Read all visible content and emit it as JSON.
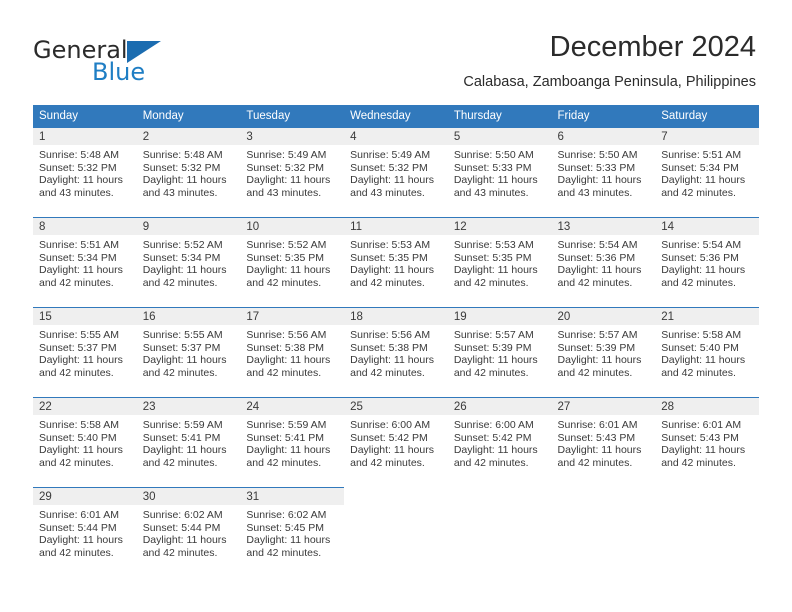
{
  "brand": {
    "name_part1": "General",
    "name_part2": "Blue",
    "triangle_icon": "blue-triangle-logo-mark",
    "accent_color": "#1b6cb0"
  },
  "header": {
    "title": "December 2024",
    "subtitle": "Calabasa, Zamboanga Peninsula, Philippines"
  },
  "calendar": {
    "header_bg": "#3179bc",
    "daynum_bg": "#efefef",
    "weekdays": [
      "Sunday",
      "Monday",
      "Tuesday",
      "Wednesday",
      "Thursday",
      "Friday",
      "Saturday"
    ],
    "weeks": [
      [
        {
          "day": "1",
          "sunrise": "Sunrise: 5:48 AM",
          "sunset": "Sunset: 5:32 PM",
          "daylight1": "Daylight: 11 hours",
          "daylight2": "and 43 minutes."
        },
        {
          "day": "2",
          "sunrise": "Sunrise: 5:48 AM",
          "sunset": "Sunset: 5:32 PM",
          "daylight1": "Daylight: 11 hours",
          "daylight2": "and 43 minutes."
        },
        {
          "day": "3",
          "sunrise": "Sunrise: 5:49 AM",
          "sunset": "Sunset: 5:32 PM",
          "daylight1": "Daylight: 11 hours",
          "daylight2": "and 43 minutes."
        },
        {
          "day": "4",
          "sunrise": "Sunrise: 5:49 AM",
          "sunset": "Sunset: 5:32 PM",
          "daylight1": "Daylight: 11 hours",
          "daylight2": "and 43 minutes."
        },
        {
          "day": "5",
          "sunrise": "Sunrise: 5:50 AM",
          "sunset": "Sunset: 5:33 PM",
          "daylight1": "Daylight: 11 hours",
          "daylight2": "and 43 minutes."
        },
        {
          "day": "6",
          "sunrise": "Sunrise: 5:50 AM",
          "sunset": "Sunset: 5:33 PM",
          "daylight1": "Daylight: 11 hours",
          "daylight2": "and 43 minutes."
        },
        {
          "day": "7",
          "sunrise": "Sunrise: 5:51 AM",
          "sunset": "Sunset: 5:34 PM",
          "daylight1": "Daylight: 11 hours",
          "daylight2": "and 42 minutes."
        }
      ],
      [
        {
          "day": "8",
          "sunrise": "Sunrise: 5:51 AM",
          "sunset": "Sunset: 5:34 PM",
          "daylight1": "Daylight: 11 hours",
          "daylight2": "and 42 minutes."
        },
        {
          "day": "9",
          "sunrise": "Sunrise: 5:52 AM",
          "sunset": "Sunset: 5:34 PM",
          "daylight1": "Daylight: 11 hours",
          "daylight2": "and 42 minutes."
        },
        {
          "day": "10",
          "sunrise": "Sunrise: 5:52 AM",
          "sunset": "Sunset: 5:35 PM",
          "daylight1": "Daylight: 11 hours",
          "daylight2": "and 42 minutes."
        },
        {
          "day": "11",
          "sunrise": "Sunrise: 5:53 AM",
          "sunset": "Sunset: 5:35 PM",
          "daylight1": "Daylight: 11 hours",
          "daylight2": "and 42 minutes."
        },
        {
          "day": "12",
          "sunrise": "Sunrise: 5:53 AM",
          "sunset": "Sunset: 5:35 PM",
          "daylight1": "Daylight: 11 hours",
          "daylight2": "and 42 minutes."
        },
        {
          "day": "13",
          "sunrise": "Sunrise: 5:54 AM",
          "sunset": "Sunset: 5:36 PM",
          "daylight1": "Daylight: 11 hours",
          "daylight2": "and 42 minutes."
        },
        {
          "day": "14",
          "sunrise": "Sunrise: 5:54 AM",
          "sunset": "Sunset: 5:36 PM",
          "daylight1": "Daylight: 11 hours",
          "daylight2": "and 42 minutes."
        }
      ],
      [
        {
          "day": "15",
          "sunrise": "Sunrise: 5:55 AM",
          "sunset": "Sunset: 5:37 PM",
          "daylight1": "Daylight: 11 hours",
          "daylight2": "and 42 minutes."
        },
        {
          "day": "16",
          "sunrise": "Sunrise: 5:55 AM",
          "sunset": "Sunset: 5:37 PM",
          "daylight1": "Daylight: 11 hours",
          "daylight2": "and 42 minutes."
        },
        {
          "day": "17",
          "sunrise": "Sunrise: 5:56 AM",
          "sunset": "Sunset: 5:38 PM",
          "daylight1": "Daylight: 11 hours",
          "daylight2": "and 42 minutes."
        },
        {
          "day": "18",
          "sunrise": "Sunrise: 5:56 AM",
          "sunset": "Sunset: 5:38 PM",
          "daylight1": "Daylight: 11 hours",
          "daylight2": "and 42 minutes."
        },
        {
          "day": "19",
          "sunrise": "Sunrise: 5:57 AM",
          "sunset": "Sunset: 5:39 PM",
          "daylight1": "Daylight: 11 hours",
          "daylight2": "and 42 minutes."
        },
        {
          "day": "20",
          "sunrise": "Sunrise: 5:57 AM",
          "sunset": "Sunset: 5:39 PM",
          "daylight1": "Daylight: 11 hours",
          "daylight2": "and 42 minutes."
        },
        {
          "day": "21",
          "sunrise": "Sunrise: 5:58 AM",
          "sunset": "Sunset: 5:40 PM",
          "daylight1": "Daylight: 11 hours",
          "daylight2": "and 42 minutes."
        }
      ],
      [
        {
          "day": "22",
          "sunrise": "Sunrise: 5:58 AM",
          "sunset": "Sunset: 5:40 PM",
          "daylight1": "Daylight: 11 hours",
          "daylight2": "and 42 minutes."
        },
        {
          "day": "23",
          "sunrise": "Sunrise: 5:59 AM",
          "sunset": "Sunset: 5:41 PM",
          "daylight1": "Daylight: 11 hours",
          "daylight2": "and 42 minutes."
        },
        {
          "day": "24",
          "sunrise": "Sunrise: 5:59 AM",
          "sunset": "Sunset: 5:41 PM",
          "daylight1": "Daylight: 11 hours",
          "daylight2": "and 42 minutes."
        },
        {
          "day": "25",
          "sunrise": "Sunrise: 6:00 AM",
          "sunset": "Sunset: 5:42 PM",
          "daylight1": "Daylight: 11 hours",
          "daylight2": "and 42 minutes."
        },
        {
          "day": "26",
          "sunrise": "Sunrise: 6:00 AM",
          "sunset": "Sunset: 5:42 PM",
          "daylight1": "Daylight: 11 hours",
          "daylight2": "and 42 minutes."
        },
        {
          "day": "27",
          "sunrise": "Sunrise: 6:01 AM",
          "sunset": "Sunset: 5:43 PM",
          "daylight1": "Daylight: 11 hours",
          "daylight2": "and 42 minutes."
        },
        {
          "day": "28",
          "sunrise": "Sunrise: 6:01 AM",
          "sunset": "Sunset: 5:43 PM",
          "daylight1": "Daylight: 11 hours",
          "daylight2": "and 42 minutes."
        }
      ],
      [
        {
          "day": "29",
          "sunrise": "Sunrise: 6:01 AM",
          "sunset": "Sunset: 5:44 PM",
          "daylight1": "Daylight: 11 hours",
          "daylight2": "and 42 minutes."
        },
        {
          "day": "30",
          "sunrise": "Sunrise: 6:02 AM",
          "sunset": "Sunset: 5:44 PM",
          "daylight1": "Daylight: 11 hours",
          "daylight2": "and 42 minutes."
        },
        {
          "day": "31",
          "sunrise": "Sunrise: 6:02 AM",
          "sunset": "Sunset: 5:45 PM",
          "daylight1": "Daylight: 11 hours",
          "daylight2": "and 42 minutes."
        },
        {
          "day": "",
          "sunrise": "",
          "sunset": "",
          "daylight1": "",
          "daylight2": ""
        },
        {
          "day": "",
          "sunrise": "",
          "sunset": "",
          "daylight1": "",
          "daylight2": ""
        },
        {
          "day": "",
          "sunrise": "",
          "sunset": "",
          "daylight1": "",
          "daylight2": ""
        },
        {
          "day": "",
          "sunrise": "",
          "sunset": "",
          "daylight1": "",
          "daylight2": ""
        }
      ]
    ]
  }
}
